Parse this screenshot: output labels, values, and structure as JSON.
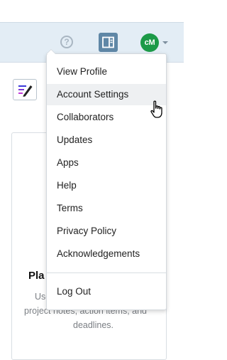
{
  "header": {
    "help_icon_glyph": "?",
    "avatar_initials": "cM",
    "avatar_color": "#1c9a48"
  },
  "menu": {
    "items": [
      {
        "label": "View Profile"
      },
      {
        "label": "Account Settings",
        "hovered": true
      },
      {
        "label": "Collaborators"
      },
      {
        "label": "Updates"
      },
      {
        "label": "Apps"
      },
      {
        "label": "Help"
      },
      {
        "label": "Terms"
      },
      {
        "label": "Privacy Policy"
      },
      {
        "label": "Acknowledgements"
      },
      {
        "label": "Log Out"
      }
    ]
  },
  "card": {
    "title": "Pla",
    "desc_line1": "Use",
    "desc_line2": "project notes, action items, and",
    "desc_line3": "deadlines."
  }
}
